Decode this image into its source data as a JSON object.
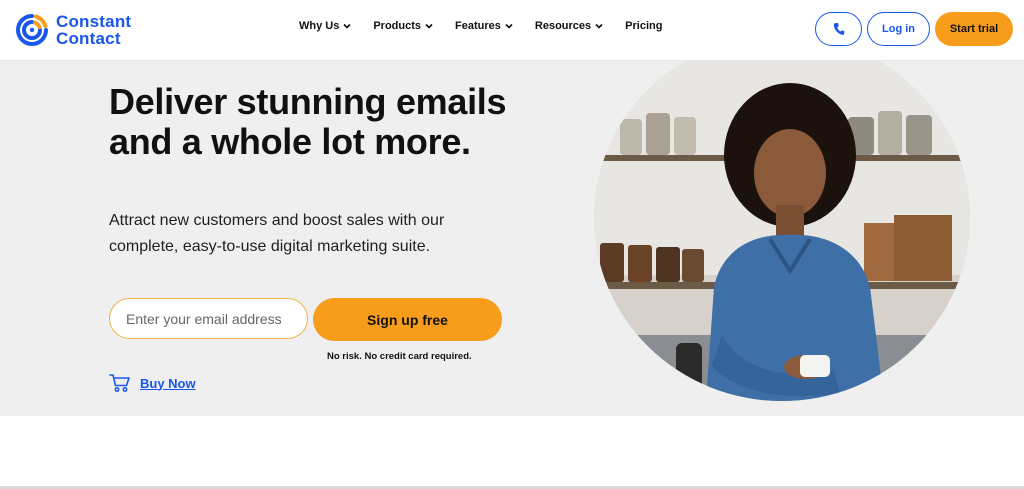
{
  "brand": {
    "name_line1": "Constant",
    "name_line2": "Contact",
    "logo_icon": "concentric-arc-logo-icon",
    "brand_blue": "#1856ed",
    "accent_orange": "#f89c1c"
  },
  "nav": {
    "items": [
      {
        "label": "Why Us",
        "has_dropdown": true
      },
      {
        "label": "Products",
        "has_dropdown": true
      },
      {
        "label": "Features",
        "has_dropdown": true
      },
      {
        "label": "Resources",
        "has_dropdown": true
      },
      {
        "label": "Pricing",
        "has_dropdown": false
      }
    ],
    "phone_icon": "phone-icon",
    "login_label": "Log in",
    "trial_label": "Start trial"
  },
  "hero": {
    "headline": "Deliver stunning emails and a whole lot more.",
    "subtext": "Attract new customers and boost sales with our complete, easy-to-use digital marketing suite.",
    "email_placeholder": "Enter your email address",
    "signup_label": "Sign up free",
    "disclaimer": "No risk. No credit card required.",
    "buy_now_label": "Buy Now",
    "buy_now_icon": "shopping-cart-icon",
    "hero_image": "woman-in-denim-shirt-photo"
  }
}
